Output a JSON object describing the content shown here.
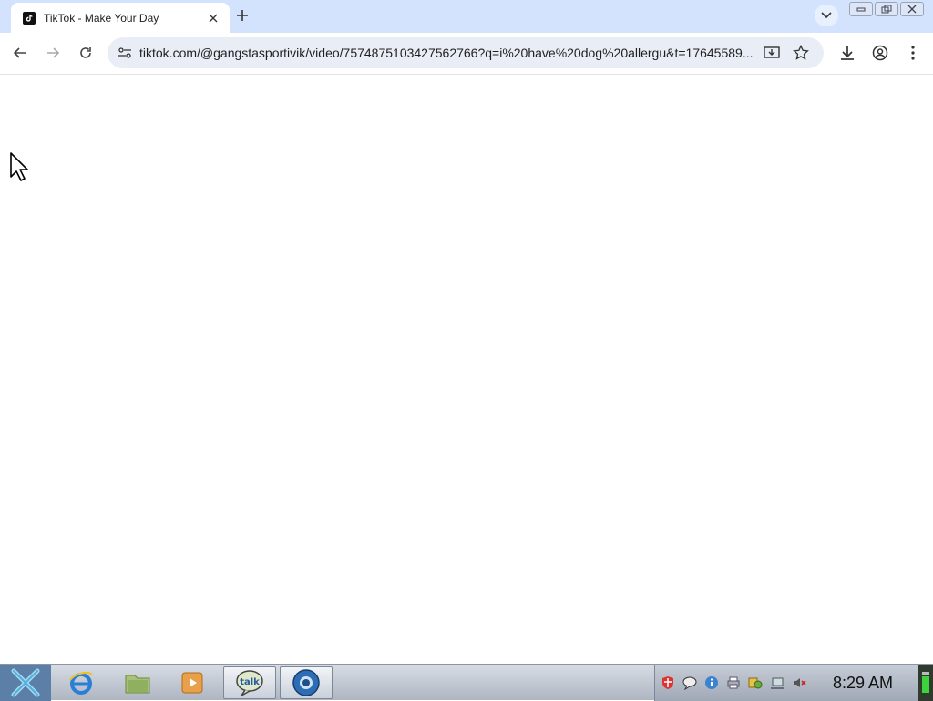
{
  "tab": {
    "title": "TikTok - Make Your Day"
  },
  "address_bar": {
    "url": "tiktok.com/@gangstasportivik/video/7574875103427562766?q=i%20have%20dog%20allergu&t=17645589..."
  },
  "taskbar": {
    "clock": "8:29 AM",
    "apps": [
      "internet-explorer",
      "file-manager",
      "media-player",
      "google-talk",
      "browser"
    ]
  },
  "colors": {
    "tabstrip": "#d3e3fd",
    "omnibox": "#e9eef6",
    "taskbar": "#aeb6c2"
  }
}
